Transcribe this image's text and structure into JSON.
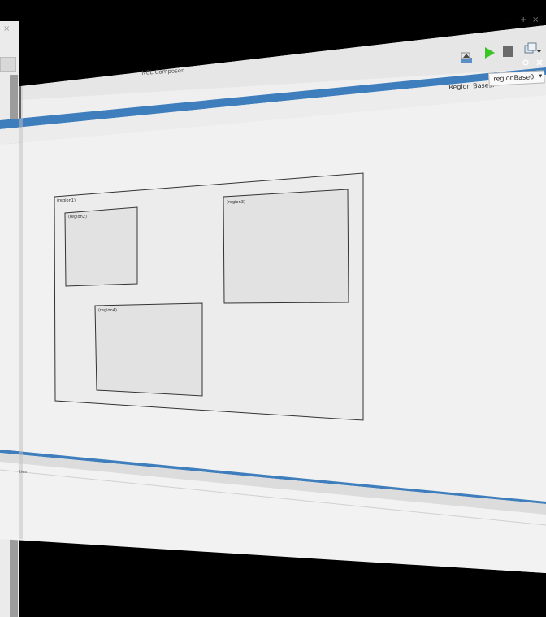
{
  "app": {
    "window_title": "NCL Composer"
  },
  "background_window": {
    "close_glyph": "×"
  },
  "window_controls": {
    "minimize": "–",
    "maximize": "+",
    "close": "×"
  },
  "toolbar": {
    "publish_icon": "publish-icon",
    "run_icon": "play-icon",
    "stop_icon": "stop-icon",
    "perspective_icon": "perspective-icon"
  },
  "layout_view": {
    "region_bases_label": "Region Bases:",
    "region_base_selected": "regionBase0",
    "dropdown_arrow": "▾",
    "regions": [
      {
        "id": "region1",
        "label": "(region1)"
      },
      {
        "id": "region2",
        "label": "(region2)"
      },
      {
        "id": "region3",
        "label": "(region3)"
      },
      {
        "id": "region4",
        "label": "(region4)"
      }
    ]
  },
  "bottom_dock": {
    "label": "ties"
  },
  "colors": {
    "accent": "#3f7ebc",
    "play": "#39c524",
    "canvas": "#f0f0f0",
    "region_fill": "#e3e3e3",
    "background": "#000000"
  }
}
